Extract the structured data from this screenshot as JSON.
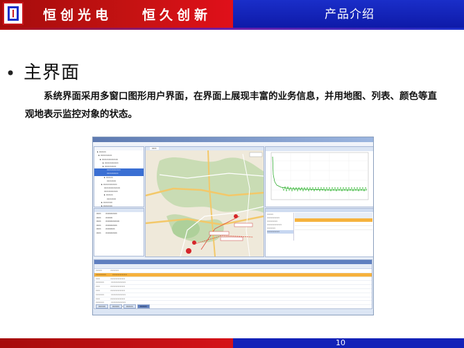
{
  "header": {
    "brand_left": "恒创光电",
    "brand_right": "恒久创新",
    "title": "产品介绍"
  },
  "bullet": "•",
  "heading": "主界面",
  "description": "系统界面采用多窗口图形用户界面，在界面上展现丰富的业务信息，并用地图、列表、颜色等直观地表示监控对象的状态。",
  "page_number": "10",
  "colors": {
    "red": "#c41212",
    "blue": "#1a2ec9",
    "accent_orange": "#f6b23d"
  }
}
